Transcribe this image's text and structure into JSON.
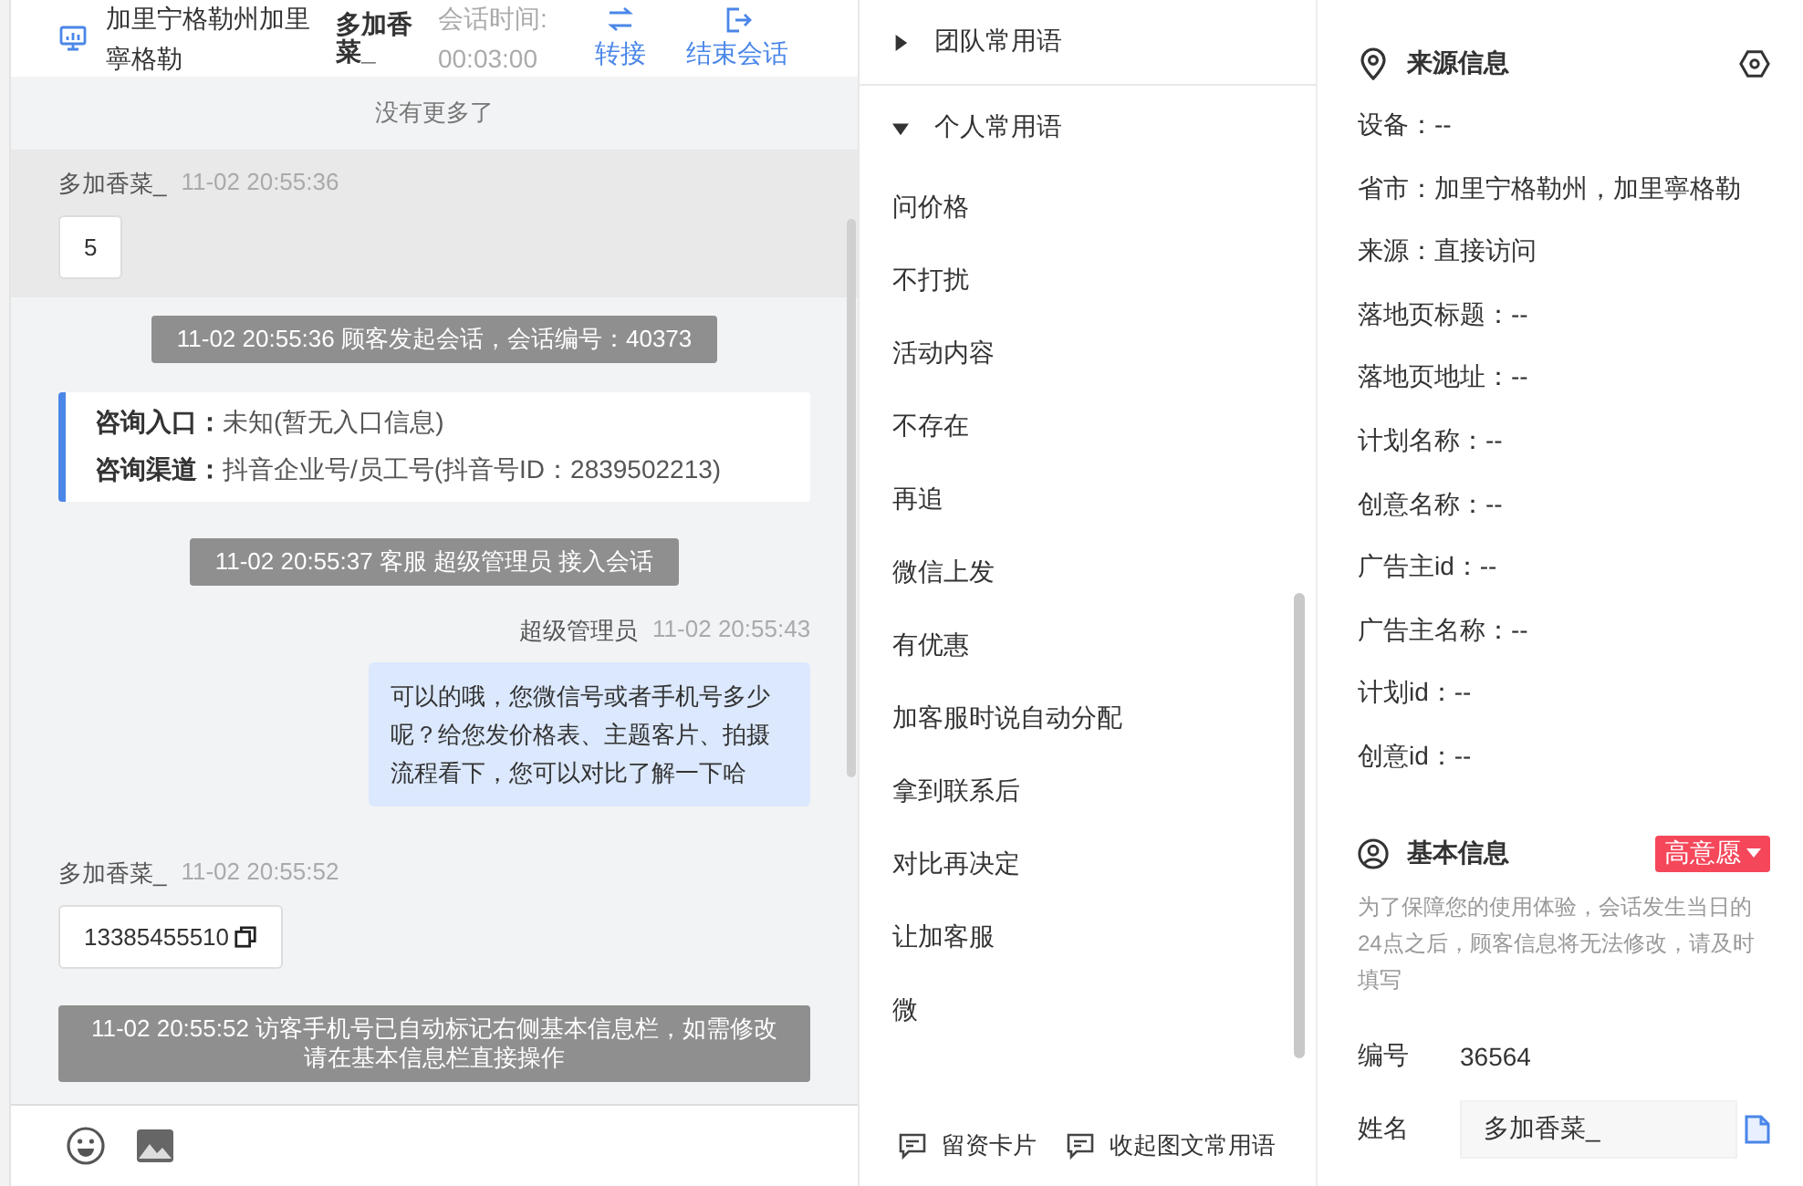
{
  "header": {
    "location": "加里宁格勒州加里寧格勒",
    "visitor": "多加香菜_",
    "duration_label": "会话时间:",
    "duration": "00:03:00",
    "actions": [
      {
        "kind": "transfer",
        "label": "转接"
      },
      {
        "kind": "end",
        "label": "结束会话"
      }
    ]
  },
  "chat": [
    {
      "kind": "notice",
      "text": "没有更多了"
    },
    {
      "kind": "customer",
      "name": "多加香菜_",
      "time": "11-02 20:55:36",
      "text": "5",
      "highlighted": true,
      "copyable": false
    },
    {
      "kind": "system",
      "text": "11-02 20:55:36 顾客发起会话，会话编号：40373"
    },
    {
      "kind": "source",
      "rows": [
        {
          "label": "咨询入口：",
          "value": "未知(暂无入口信息)"
        },
        {
          "label": "咨询渠道：",
          "value": "抖音企业号/员工号(抖音号ID：2839502213)"
        }
      ]
    },
    {
      "kind": "system",
      "text": "11-02 20:55:37 客服 超级管理员 接入会话"
    },
    {
      "kind": "agent",
      "name": "超级管理员",
      "time": "11-02 20:55:43",
      "text": "可以的哦，您微信号或者手机号多少呢？给您发价格表、主题客片、拍摄流程看下，您可以对比了解一下哈"
    },
    {
      "kind": "customer",
      "name": "多加香菜_",
      "time": "11-02 20:55:52",
      "text": "13385455510",
      "highlighted": false,
      "copyable": true
    },
    {
      "kind": "system",
      "text": "11-02 20:55:52 访客手机号已自动标记右侧基本信息栏，如需修改请在基本信息栏直接操作"
    }
  ],
  "phrases": {
    "groups": [
      {
        "label": "团队常用语",
        "expanded": false
      },
      {
        "label": "个人常用语",
        "expanded": true,
        "items": [
          "问价格",
          "不打扰",
          "活动内容",
          "不存在",
          "再追",
          "微信上发",
          "有优惠",
          "加客服时说自动分配",
          "拿到联系后",
          "对比再决定",
          "让加客服",
          "微"
        ]
      }
    ],
    "footer": [
      "留资卡片",
      "收起图文常用语"
    ]
  },
  "source_info": {
    "title": "来源信息",
    "fields": [
      "设备：--",
      "省市：加里宁格勒州，加里寧格勒",
      "来源：直接访问",
      "落地页标题：--",
      "落地页地址：--",
      "计划名称：--",
      "创意名称：--",
      "广告主id：--",
      "广告主名称：--",
      "计划id：--",
      "创意id：--"
    ]
  },
  "basic_info": {
    "title": "基本信息",
    "tag": "高意愿",
    "note": "为了保障您的使用体验，会话发生当日的24点之后，顾客信息将无法修改，请及时填写",
    "id_label": "编号",
    "id": "36564",
    "name_label": "姓名",
    "name": "多加香菜_"
  }
}
